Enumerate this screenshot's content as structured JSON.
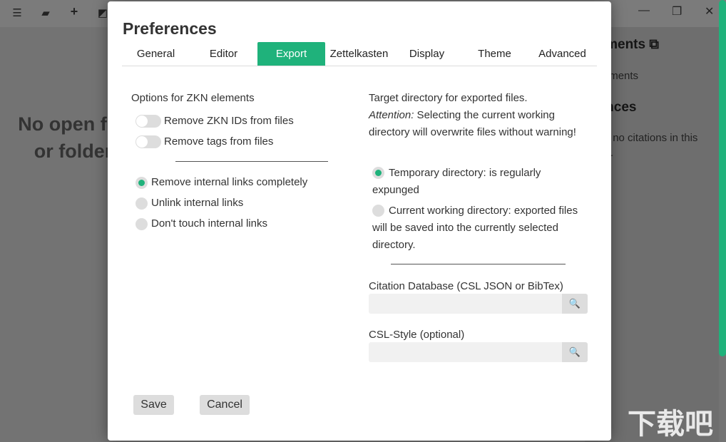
{
  "toolbar": {
    "icons": [
      "menu-icon",
      "folder-open-icon",
      "plus-icon",
      "image-icon"
    ]
  },
  "window": {
    "minimize": "—",
    "maximize": "❐",
    "close": "✕"
  },
  "main": {
    "empty_line1": "No open files",
    "empty_line2": "or folders"
  },
  "sidebar": {
    "attachments_title": "Attachments",
    "attachments_text": "No attachments",
    "references_title": "References",
    "references_text": "There are no citations in this document."
  },
  "dialog": {
    "title": "Preferences",
    "tabs": [
      "General",
      "Editor",
      "Export",
      "Zettelkasten",
      "Display",
      "Theme",
      "Advanced"
    ],
    "active_tab": "Export",
    "left": {
      "heading": "Options for ZKN elements",
      "toggles": [
        {
          "label": "Remove ZKN IDs from files",
          "on": false
        },
        {
          "label": "Remove tags from files",
          "on": false
        }
      ],
      "radios": [
        {
          "label": "Remove internal links completely",
          "checked": true
        },
        {
          "label": "Unlink internal links",
          "checked": false
        },
        {
          "label": "Don't touch internal links",
          "checked": false
        }
      ]
    },
    "right": {
      "heading": "Target directory for exported files.",
      "attention_label": "Attention:",
      "attention_text": " Selecting the current working directory will overwrite files without warning!",
      "radio1": "Temporary directory: is regularly expunged",
      "radio2": "Current working directory: exported files will be saved into the currently selected directory.",
      "citation_label": "Citation Database (CSL JSON or BibTex)",
      "citation_value": "",
      "csl_label": "CSL-Style (optional)",
      "csl_value": ""
    },
    "save": "Save",
    "cancel": "Cancel"
  },
  "colors": {
    "accent": "#1fb27b"
  },
  "watermark": "下载吧"
}
